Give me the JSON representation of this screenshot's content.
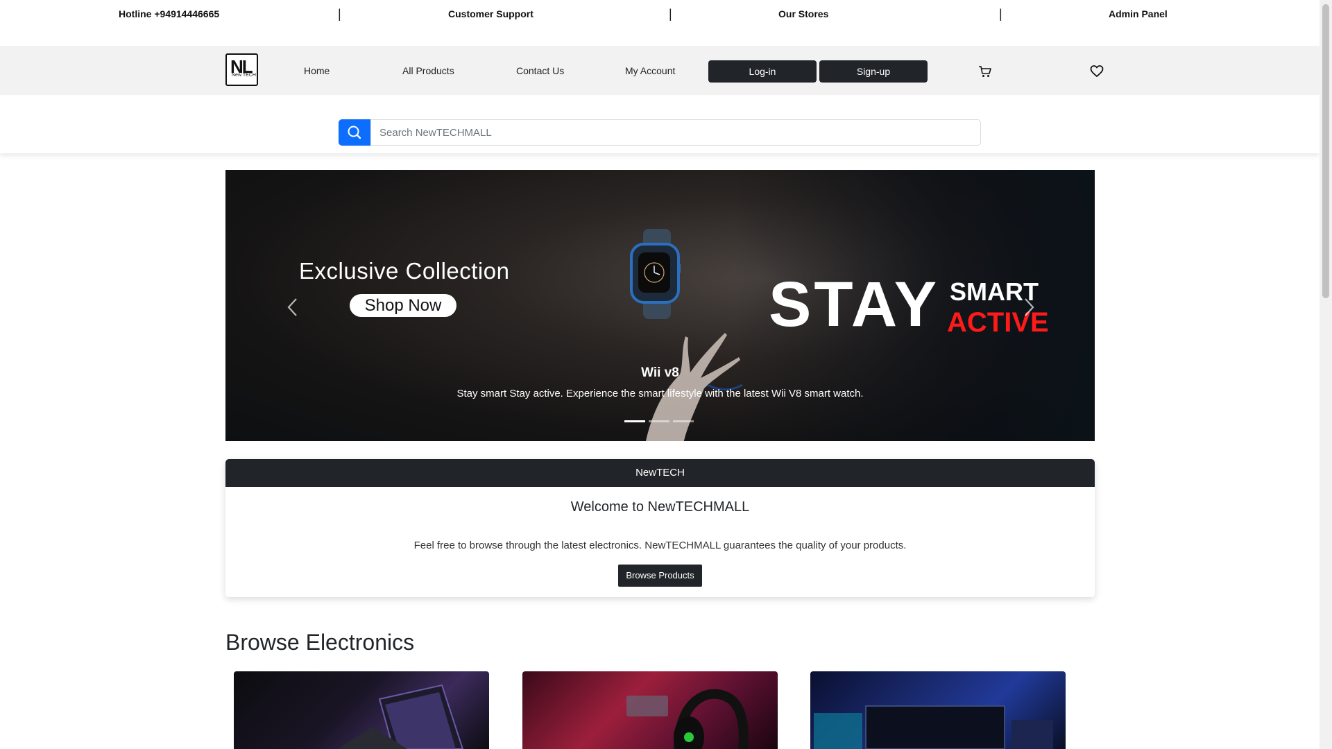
{
  "topbar": {
    "hotline": "Hotline +94914446665",
    "support": "Customer Support",
    "stores": "Our Stores",
    "admin": "Admin Panel",
    "separator": "|"
  },
  "navbar": {
    "logo_big": "NL",
    "logo_small": "New TECH",
    "links": [
      "Home",
      "All Products",
      "Contact Us",
      "My Account"
    ],
    "login": "Log-in",
    "signup": "Sign-up",
    "cart_icon": "cart-icon",
    "wishlist_icon": "heart-icon"
  },
  "search": {
    "placeholder": "Search NewTECHMALL",
    "icon": "search-icon"
  },
  "carousel": {
    "headline": "Exclusive Collection",
    "shop_button": "Shop Now",
    "stay": "STAY",
    "smart": "SMART",
    "active": "ACTIVE",
    "caption_title": "Wii v8",
    "caption_text": "Stay smart Stay active. Experience the smart lifestyle with the latest Wii V8 smart watch.",
    "slide_count": 3,
    "active_slide": 1,
    "accent_color": "#ff1a1a"
  },
  "welcome": {
    "header": "NewTECH",
    "title": "Welcome to NewTECHMALL",
    "text": "Feel free to browse through the latest electronics. NewTECHMALL guarantees the quality of your products.",
    "button": "Browse Products"
  },
  "browse": {
    "title": "Browse Electronics",
    "products": [
      "laptop-image",
      "headset-image",
      "monitor-image"
    ]
  },
  "colors": {
    "primary": "#0d6efd",
    "dark": "#212529"
  }
}
